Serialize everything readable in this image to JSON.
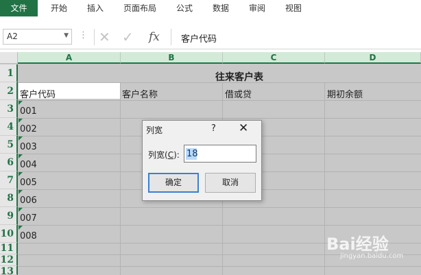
{
  "ribbon": {
    "tabs": [
      "文件",
      "开始",
      "插入",
      "页面布局",
      "公式",
      "数据",
      "审阅",
      "视图"
    ],
    "accent": "#217346"
  },
  "formula_bar": {
    "name_box": "A2",
    "separator": "⋮",
    "icons": [
      "cancel-icon",
      "enter-icon",
      "function-icon"
    ],
    "fx_label": "fx",
    "formula": "客户代码"
  },
  "sheet": {
    "columns": [
      "A",
      "B",
      "C",
      "D"
    ],
    "rows": [
      "1",
      "2",
      "3",
      "4",
      "5",
      "6",
      "7",
      "8",
      "9",
      "10",
      "11",
      "12",
      "13"
    ],
    "title": "往来客户表",
    "headers": [
      "客户代码",
      "客户名称",
      "借或贷",
      "期初余额"
    ],
    "codes": [
      "001",
      "002",
      "003",
      "004",
      "005",
      "006",
      "007",
      "008"
    ],
    "selected_fill": "#c8c8c8"
  },
  "dialog": {
    "title": "列宽",
    "help": "?",
    "close": "✕",
    "label_prefix": "列宽(",
    "label_key": "C",
    "label_suffix": "):",
    "value": "18",
    "ok": "确定",
    "cancel": "取消"
  },
  "watermark": {
    "brand": "Bai经验",
    "url": "jingyan.baidu.com"
  }
}
